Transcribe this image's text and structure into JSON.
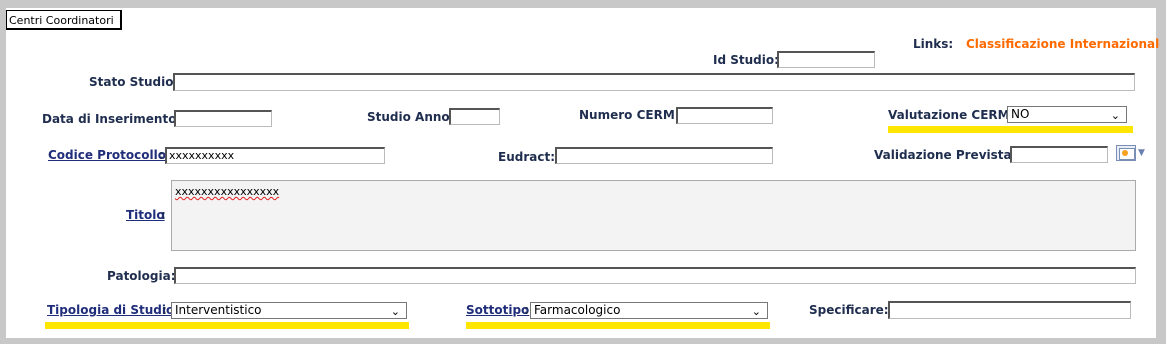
{
  "tab": {
    "label": "Centri Coordinatori"
  },
  "links": {
    "label": "Links:",
    "value": "Classificazione Internazionale d"
  },
  "fields": {
    "id_studio": {
      "label": "Id Studio",
      "value": ""
    },
    "stato_studio": {
      "label": "Stato Studio",
      "value": ""
    },
    "data_inserimento": {
      "label": "Data di Inserimento",
      "value": ""
    },
    "studio_anno": {
      "label": "Studio Anno",
      "value": ""
    },
    "numero_cerm": {
      "label": "Numero CERM",
      "value": ""
    },
    "valutazione_cerm": {
      "label": "Valutazione CERM",
      "value": "NO"
    },
    "codice_protocollo": {
      "label": "Codice Protocollo",
      "value": "xxxxxxxxxx"
    },
    "eudract": {
      "label": "Eudract",
      "value": ""
    },
    "validazione_prevista": {
      "label": "Validazione Prevista",
      "value": ""
    },
    "titolo": {
      "label": "Titolo",
      "value": "xxxxxxxxxxxxxxxx"
    },
    "patologia": {
      "label": "Patologia",
      "value": ""
    },
    "tipologia_studio": {
      "label": "Tipologia di Studio",
      "value": "Interventistico"
    },
    "sottotipo": {
      "label": "Sottotipo",
      "value": "Farmacologico"
    },
    "specificare": {
      "label": "Specificare",
      "value": ""
    }
  },
  "colors": {
    "highlight": "#ffe600",
    "links_accent": "#ff6a00",
    "label": "#1f2d4e"
  },
  "icons": {
    "calendar": "calendar-icon",
    "dropdown": "chevron-down-icon"
  }
}
